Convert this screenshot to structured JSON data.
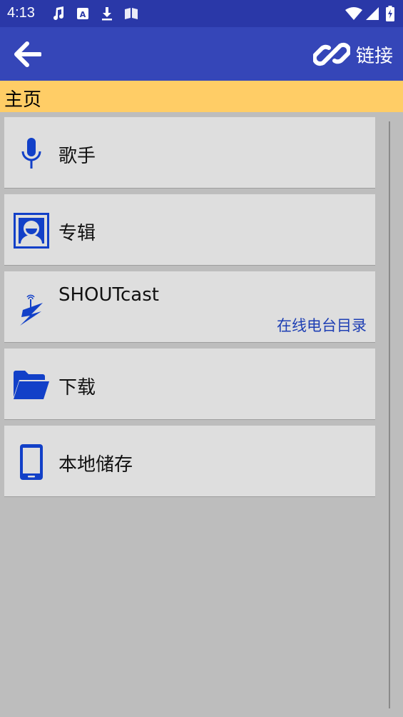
{
  "status_bar": {
    "time": "4:13",
    "icons": [
      "music-note-icon",
      "translate-a-icon",
      "download-icon",
      "book-icon",
      "wifi-icon",
      "signal-icon",
      "battery-charging-icon"
    ]
  },
  "app_bar": {
    "back_icon": "arrow-left-icon",
    "link_icon": "link-icon",
    "link_label": "链接"
  },
  "breadcrumb": {
    "label": "主页"
  },
  "items": [
    {
      "icon": "microphone-icon",
      "title": "歌手",
      "subtitle": ""
    },
    {
      "icon": "album-portrait-icon",
      "title": "专辑",
      "subtitle": ""
    },
    {
      "icon": "shoutcast-bolt-icon",
      "title": "SHOUTcast",
      "subtitle": "在线电台目录"
    },
    {
      "icon": "folder-open-icon",
      "title": "下载",
      "subtitle": ""
    },
    {
      "icon": "phone-icon",
      "title": "本地储存",
      "subtitle": ""
    }
  ],
  "colors": {
    "status_bar": "#2a38a8",
    "app_bar": "#3546b8",
    "breadcrumb_bg": "#ffcd66",
    "icon_blue": "#1240c8",
    "subtitle_blue": "#1e3fb4",
    "item_bg": "#dedede",
    "page_bg": "#bdbdbd"
  }
}
